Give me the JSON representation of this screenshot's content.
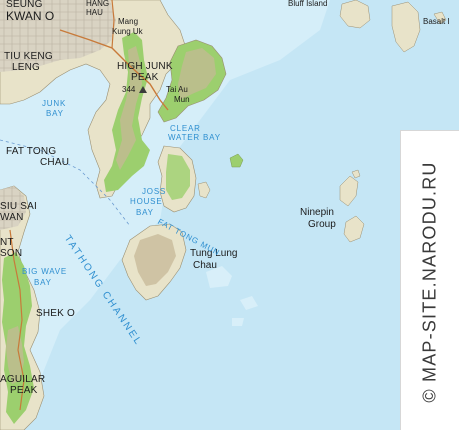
{
  "map": {
    "place_labels": {
      "kwan_o_top": "SEUNG",
      "kwan_o": "KWAN O",
      "hang_hau_1": "HANG",
      "hang_hau_2": "HAU",
      "mang_kung_uk_1": "Mang",
      "mang_kung_uk_2": "Kung Uk",
      "tiu_keng_leng_1": "TIU KENG",
      "tiu_keng_leng_2": "LENG",
      "high_junk_peak_1": "HIGH JUNK",
      "high_junk_peak_2": "PEAK",
      "high_junk_peak_height": "344",
      "tai_au_mun_1": "Tai Au",
      "tai_au_mun_2": "Mun",
      "fat_tong_chau_1": "FAT TONG",
      "fat_tong_chau_2": "CHAU",
      "siu_sai_wan_1": "SIU SAI",
      "siu_sai_wan_2": "WAN",
      "hk_nt": "NT",
      "hk_son": "SON",
      "shek_o": "SHEK O",
      "d_aguilar_peak_1": "AGUILAR",
      "d_aguilar_peak_2": "PEAK",
      "tung_lung_chau_1": "Tung Lung",
      "tung_lung_chau_2": "Chau",
      "ninepin_group_1": "Ninepin",
      "ninepin_group_2": "Group",
      "bluff_island": "Bluff Island",
      "basalt_island": "Basalt I"
    },
    "water_labels": {
      "junk_bay_1": "JUNK",
      "junk_bay_2": "BAY",
      "clear_water_bay_1": "CLEAR",
      "clear_water_bay_2": "WATER BAY",
      "joss_house_bay_1": "JOSS",
      "joss_house_bay_2": "HOUSE",
      "joss_house_bay_3": "BAY",
      "fat_tong_mun": "FAT TONG MUN",
      "big_wave_bay_1": "BIG WAVE",
      "big_wave_bay_2": "BAY",
      "tathong_channel": "TATHONG CHANNEL"
    },
    "watermark": "© MAP-SITE.NARODU.RU",
    "colors": {
      "sea": "#c5e6f5",
      "land": "#e8e3c9",
      "vegetation": "#9ccf6e",
      "relief": "#c7b897",
      "urban": "#d9d3c3",
      "road": "#c87a3a",
      "water_text": "#2f8fd0"
    }
  }
}
